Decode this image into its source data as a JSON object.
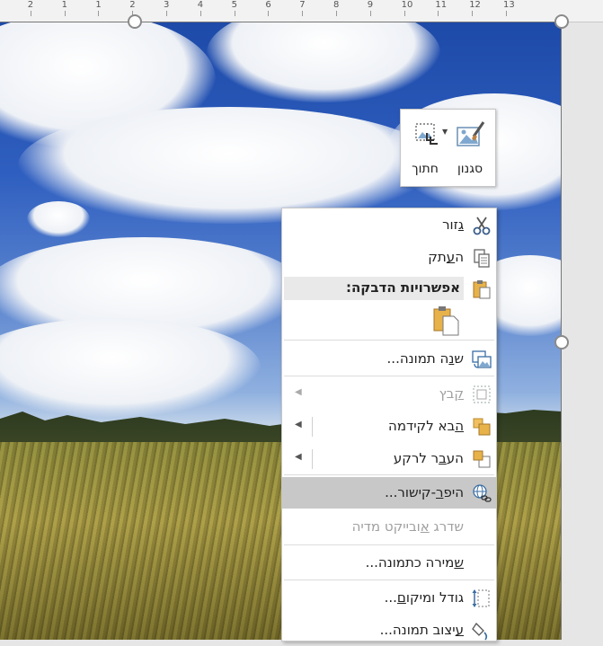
{
  "ruler": {
    "ticks": [
      "3",
      "2",
      "1",
      "1",
      "2",
      "3",
      "4",
      "5",
      "6",
      "7",
      "8",
      "9",
      "10",
      "11",
      "12",
      "13"
    ]
  },
  "mini_toolbar": {
    "style_label": "סגנון",
    "crop_label": "חתוך"
  },
  "context_menu": {
    "cut": {
      "pre": "",
      "u": "ג",
      "post": "זור"
    },
    "copy": {
      "pre": "ה",
      "u": "ע",
      "post": "תק"
    },
    "paste_options_label": "אפשרויות הדבקה:",
    "change_picture": {
      "pre": "ש",
      "u": "נ",
      "post": "ה תמונה..."
    },
    "group": {
      "pre": "",
      "u": "ק",
      "post": "בץ"
    },
    "bring_forward": {
      "pre": "",
      "u": "ה",
      "post": "בא לקידמה"
    },
    "send_backward": {
      "pre": "הע",
      "u": "ב",
      "post": "ר לרקע"
    },
    "hyperlink": {
      "pre": "היפ",
      "u": "ר",
      "post": "-קישור..."
    },
    "upgrade_media": {
      "pre": "שדרג ",
      "u": "א",
      "post": "ובייקט מדיה"
    },
    "save_as_picture": {
      "pre": "",
      "u": "ש",
      "post": "מירה כתמונה..."
    },
    "size_position": {
      "pre": "גודל ומיקו",
      "u": "ם",
      "post": "..."
    },
    "format_picture": {
      "pre": "",
      "u": "ע",
      "post": "יצוב תמונה..."
    }
  }
}
